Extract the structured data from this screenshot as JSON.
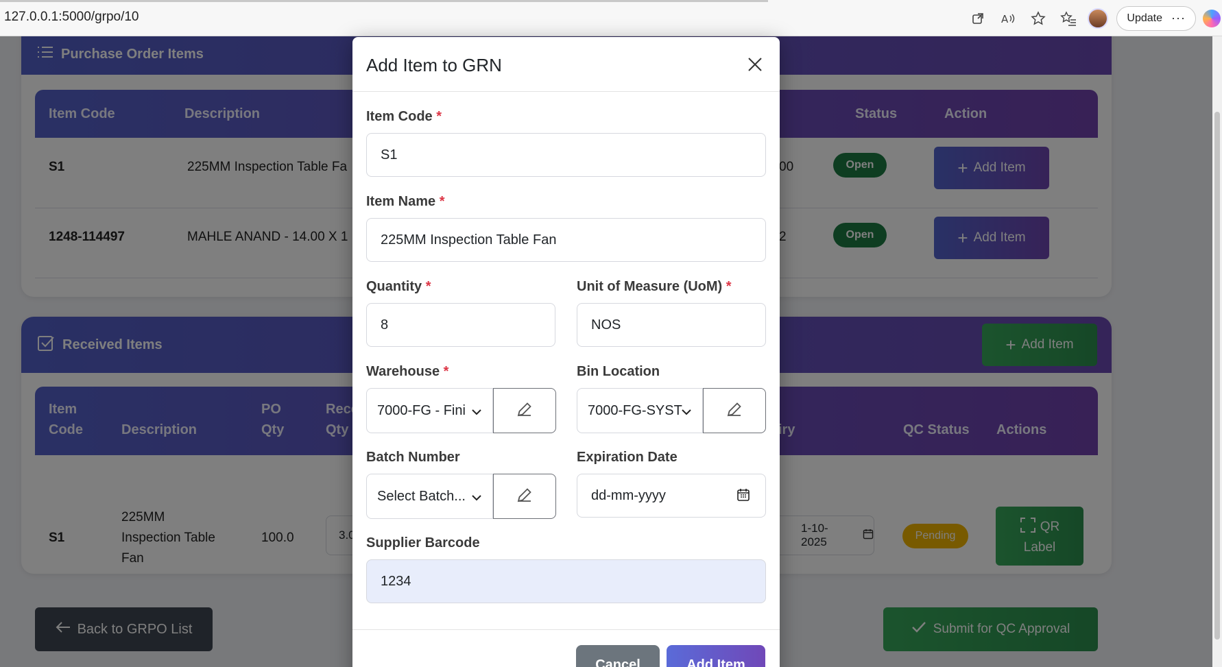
{
  "browser": {
    "url": "127.0.0.1:5000/grpo/10",
    "update_label": "Update",
    "more_label": "···"
  },
  "po_items": {
    "title": "Purchase Order Items",
    "columns": [
      "Item Code",
      "Description",
      "Status",
      "Action"
    ],
    "rows": [
      {
        "code": "S1",
        "description": "225MM Inspection Table Fa",
        "partial": "00",
        "status": "Open",
        "action": "Add Item"
      },
      {
        "code": "1248-114497",
        "description": "MAHLE ANAND - 14.00 X 1",
        "partial": "2",
        "status": "Open",
        "action": "Add Item"
      }
    ]
  },
  "received": {
    "title": "Received Items",
    "add_label": "Add Item",
    "columns": {
      "item_code_1": "Item",
      "item_code_2": "Code",
      "description": "Description",
      "po_qty_1": "PO",
      "po_qty_2": "Qty",
      "rec_qty_1": "Rece",
      "rec_qty_2": "Qty",
      "expiry_partial": "iry",
      "qc_status": "QC Status",
      "actions": "Actions"
    },
    "row": {
      "code": "S1",
      "desc_1": "225MM",
      "desc_2": "Inspection Table",
      "desc_3": "Fan",
      "po_qty": "100.0",
      "rec_qty_partial": "3.0",
      "expiry_partial": "1-10-2025",
      "qc_status": "Pending",
      "qr_1": "QR",
      "qr_2": "Label"
    }
  },
  "footer": {
    "back_label": "Back to GRPO List",
    "submit_label": "Submit for QC Approval"
  },
  "modal": {
    "title": "Add Item to GRN",
    "item_code_label": "Item Code",
    "item_code_value": "S1",
    "item_name_label": "Item Name",
    "item_name_value": "225MM Inspection Table Fan",
    "quantity_label": "Quantity",
    "quantity_value": "8",
    "uom_label": "Unit of Measure (UoM)",
    "uom_value": "NOS",
    "warehouse_label": "Warehouse",
    "warehouse_value": "7000-FG - Fini",
    "bin_label": "Bin Location",
    "bin_value": "7000-FG-SYST",
    "batch_label": "Batch Number",
    "batch_value": "Select Batch...",
    "expiry_label": "Expiration Date",
    "expiry_placeholder": "dd-mm-yyyy",
    "barcode_label": "Supplier Barcode",
    "barcode_value": "1234",
    "required_mark": "*",
    "cancel_label": "Cancel",
    "add_label": "Add Item"
  },
  "colors": {
    "accent": "#5a63c8",
    "open_badge": "#1c7a43",
    "pending_badge": "#f0b400",
    "required": "#dc3545"
  }
}
